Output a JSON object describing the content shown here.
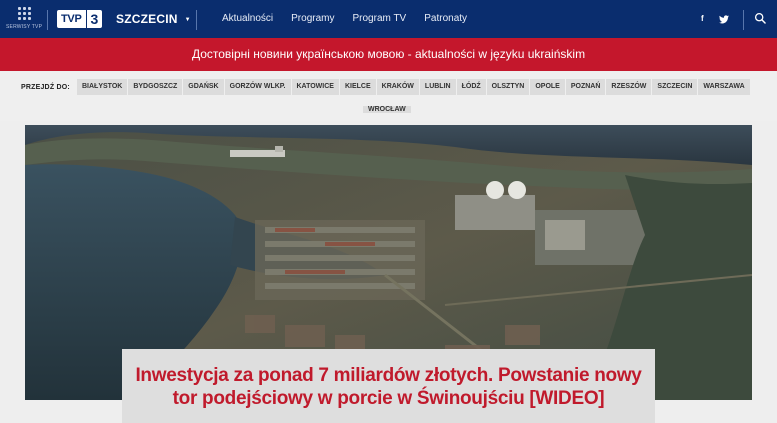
{
  "header": {
    "services_label": "SERWISY TVP",
    "logo_text": "TVP",
    "logo_number": "3",
    "region": "SZCZECIN",
    "nav": [
      "Aktualności",
      "Programy",
      "Program TV",
      "Patronaty"
    ],
    "social": {
      "facebook": "f",
      "twitter": "twitter-icon"
    }
  },
  "banner": {
    "text": "Достовірні новини українською мовою - aktualności w języku ukraińskim"
  },
  "citybar": {
    "label": "PRZEJDŹ DO:",
    "cities": [
      "BIAŁYSTOK",
      "BYDGOSZCZ",
      "GDAŃSK",
      "GORZÓW WLKP.",
      "KATOWICE",
      "KIELCE",
      "KRAKÓW",
      "LUBLIN",
      "ŁÓDŹ",
      "OLSZTYN",
      "OPOLE",
      "POZNAŃ",
      "RZESZÓW",
      "SZCZECIN",
      "WARSZAWA"
    ],
    "cities_row2": [
      "WROCŁAW"
    ]
  },
  "hero": {
    "headline": "Inwestycja za ponad 7 miliardów złotych. Powstanie nowy tor podejściowy w porcie w Świnoujściu [WIDEO]"
  },
  "colors": {
    "nav_bg": "#0a2d6e",
    "banner_bg": "#c4172c",
    "headline": "#c01a2c"
  }
}
